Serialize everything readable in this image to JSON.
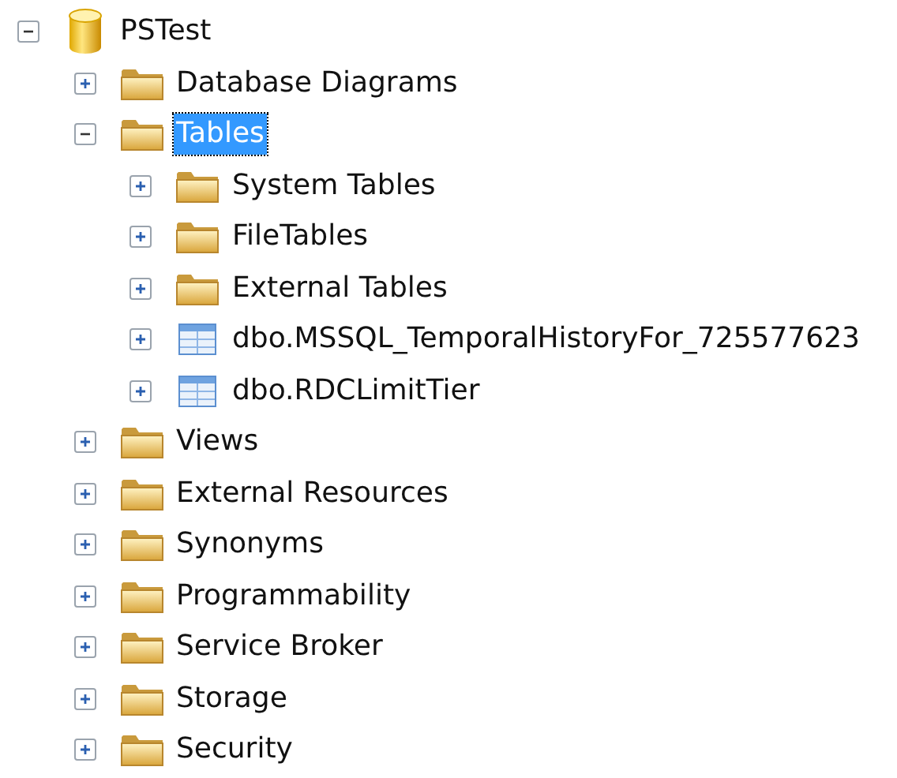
{
  "tree": [
    {
      "label": "PSTest",
      "kind": "database",
      "expanded": true,
      "selected": false,
      "children": [
        {
          "label": "Database Diagrams",
          "kind": "folder",
          "expanded": false,
          "selected": false
        },
        {
          "label": "Tables",
          "kind": "folder",
          "expanded": true,
          "selected": true,
          "children": [
            {
              "label": "System Tables",
              "kind": "folder",
              "expanded": false,
              "selected": false
            },
            {
              "label": "FileTables",
              "kind": "folder",
              "expanded": false,
              "selected": false
            },
            {
              "label": "External Tables",
              "kind": "folder",
              "expanded": false,
              "selected": false
            },
            {
              "label": "dbo.MSSQL_TemporalHistoryFor_725577623",
              "kind": "table",
              "expanded": false,
              "selected": false
            },
            {
              "label": "dbo.RDCLimitTier",
              "kind": "table",
              "expanded": false,
              "selected": false
            }
          ]
        },
        {
          "label": "Views",
          "kind": "folder",
          "expanded": false,
          "selected": false
        },
        {
          "label": "External Resources",
          "kind": "folder",
          "expanded": false,
          "selected": false
        },
        {
          "label": "Synonyms",
          "kind": "folder",
          "expanded": false,
          "selected": false
        },
        {
          "label": "Programmability",
          "kind": "folder",
          "expanded": false,
          "selected": false
        },
        {
          "label": "Service Broker",
          "kind": "folder",
          "expanded": false,
          "selected": false
        },
        {
          "label": "Storage",
          "kind": "folder",
          "expanded": false,
          "selected": false
        },
        {
          "label": "Security",
          "kind": "folder",
          "expanded": false,
          "selected": false
        }
      ]
    }
  ]
}
